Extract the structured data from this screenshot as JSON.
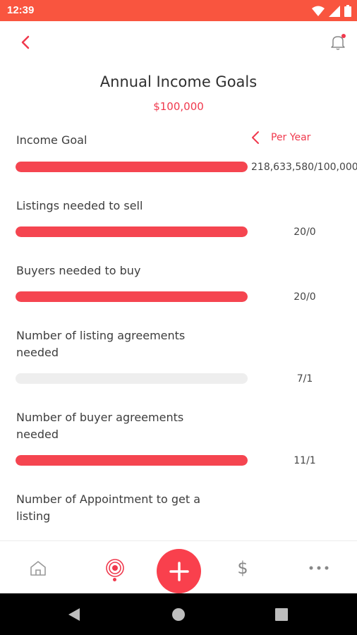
{
  "status_bar": {
    "time": "12:39"
  },
  "header": {
    "title": "Annual Income Goals",
    "subtitle": "$100,000"
  },
  "period": {
    "label": "Per Year"
  },
  "goals": [
    {
      "label": "Income Goal",
      "ratio": "218,633,580/100,000",
      "progress": 1.0
    },
    {
      "label": "Listings needed to sell",
      "ratio": "20/0",
      "progress": 1.0
    },
    {
      "label": "Buyers needed to buy",
      "ratio": "20/0",
      "progress": 1.0
    },
    {
      "label": "Number of listing agreements needed",
      "ratio": "7/1",
      "progress": 0.0
    },
    {
      "label": "Number of buyer agreements needed",
      "ratio": "11/1",
      "progress": 1.0
    },
    {
      "label": "Number of Appointment to get a listing"
    }
  ],
  "colors": {
    "accent": "#f0394d",
    "status_bar": "#f9553f",
    "bar_fill": "#f54550",
    "bar_track": "#eeeeee"
  },
  "icons": {
    "back": "back-chevron-icon",
    "bell": "bell-icon",
    "home": "home-icon",
    "target": "target-icon",
    "add": "plus-icon",
    "dollar": "dollar-icon",
    "more": "more-dots-icon"
  }
}
